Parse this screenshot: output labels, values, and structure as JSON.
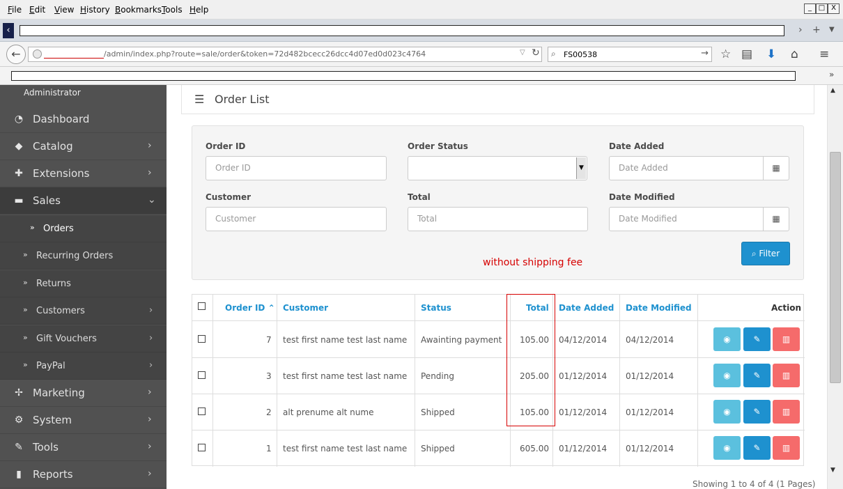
{
  "browser": {
    "menu": [
      "File",
      "Edit",
      "View",
      "History",
      "Bookmarks",
      "Tools",
      "Help"
    ],
    "menu_underline": [
      "F",
      "E",
      "V",
      "H",
      "B",
      "T",
      "H"
    ],
    "menu_rest": [
      "ile",
      "dit",
      "iew",
      "istory",
      "ookmarks",
      "ools",
      "elp"
    ],
    "window_buttons": [
      "_",
      "□",
      "X"
    ],
    "url": "/admin/index.php?route=sale/order&token=72d482bcecc26dcc4d07ed0d023c4764",
    "search_value": "FS00538"
  },
  "sidebar": {
    "role": "Administrator",
    "items": [
      {
        "label": "Dashboard",
        "icon": "dashboard-icon",
        "glyph": "◔"
      },
      {
        "label": "Catalog",
        "icon": "tag-icon",
        "glyph": "◆"
      },
      {
        "label": "Extensions",
        "icon": "puzzle-icon",
        "glyph": "✚"
      },
      {
        "label": "Sales",
        "icon": "cart-icon",
        "glyph": "▬"
      },
      {
        "label": "Marketing",
        "icon": "share-icon",
        "glyph": "✢"
      },
      {
        "label": "System",
        "icon": "gear-icon",
        "glyph": "⚙"
      },
      {
        "label": "Tools",
        "icon": "wrench-icon",
        "glyph": "✎"
      },
      {
        "label": "Reports",
        "icon": "bar-chart-icon",
        "glyph": "▮"
      }
    ],
    "sales_sub": [
      {
        "label": "Orders"
      },
      {
        "label": "Recurring Orders"
      },
      {
        "label": "Returns"
      },
      {
        "label": "Customers"
      },
      {
        "label": "Gift Vouchers"
      },
      {
        "label": "PayPal"
      }
    ]
  },
  "main": {
    "title": "Order List",
    "filter": {
      "order_id_label": "Order ID",
      "order_id_placeholder": "Order ID",
      "order_status_label": "Order Status",
      "date_added_label": "Date Added",
      "date_added_placeholder": "Date Added",
      "customer_label": "Customer",
      "customer_placeholder": "Customer",
      "total_label": "Total",
      "total_placeholder": "Total",
      "date_modified_label": "Date Modified",
      "date_modified_placeholder": "Date Modified",
      "filter_button": "Filter"
    },
    "note": "without shipping fee",
    "table": {
      "headers": {
        "order_id": "Order ID",
        "customer": "Customer",
        "status": "Status",
        "total": "Total",
        "date_added": "Date Added",
        "date_modified": "Date Modified",
        "action": "Action"
      },
      "rows": [
        {
          "order_id": "7",
          "customer": "test first name test last name",
          "status": "Awainting payment",
          "total": "105.00",
          "date_added": "04/12/2014",
          "date_modified": "04/12/2014"
        },
        {
          "order_id": "3",
          "customer": "test first name test last name",
          "status": "Pending",
          "total": "205.00",
          "date_added": "01/12/2014",
          "date_modified": "01/12/2014"
        },
        {
          "order_id": "2",
          "customer": "alt prenume alt nume",
          "status": "Shipped",
          "total": "105.00",
          "date_added": "01/12/2014",
          "date_modified": "01/12/2014"
        },
        {
          "order_id": "1",
          "customer": "test first name test last name",
          "status": "Shipped",
          "total": "605.00",
          "date_added": "01/12/2014",
          "date_modified": "01/12/2014"
        }
      ]
    },
    "pagination": "Showing 1 to 4 of 4 (1 Pages)"
  },
  "colors": {
    "sidebar_bg": "#515151",
    "link_blue": "#1e91cf",
    "note_red": "#d60000"
  }
}
